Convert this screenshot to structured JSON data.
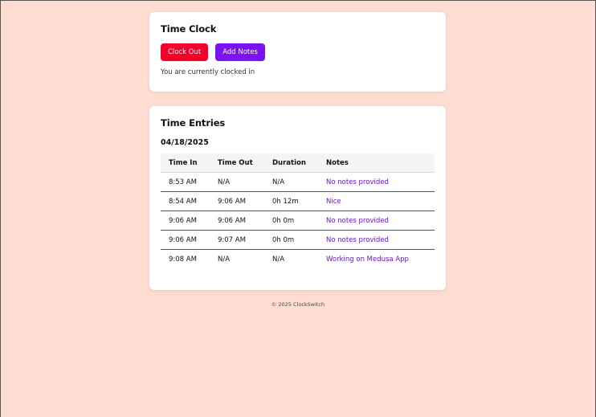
{
  "time_clock": {
    "title": "Time Clock",
    "clock_out_label": "Clock Out",
    "add_notes_label": "Add Notes",
    "status_text": "You are currently clocked in"
  },
  "time_entries": {
    "title": "Time Entries",
    "date": "04/18/2025",
    "columns": {
      "time_in": "Time In",
      "time_out": "Time Out",
      "duration": "Duration",
      "notes": "Notes"
    },
    "rows": [
      {
        "time_in": "8:53 AM",
        "time_out": "N/A",
        "duration": "N/A",
        "notes": "No notes provided"
      },
      {
        "time_in": "8:54 AM",
        "time_out": "9:06 AM",
        "duration": "0h 12m",
        "notes": "Nice"
      },
      {
        "time_in": "9:06 AM",
        "time_out": "9:06 AM",
        "duration": "0h 0m",
        "notes": "No notes provided"
      },
      {
        "time_in": "9:06 AM",
        "time_out": "9:07 AM",
        "duration": "0h 0m",
        "notes": "No notes provided"
      },
      {
        "time_in": "9:08 AM",
        "time_out": "N/A",
        "duration": "N/A",
        "notes": "Working on Medusa App"
      }
    ]
  },
  "footer": {
    "text": "© 2025 ClockSwitch"
  },
  "colors": {
    "page_background": "#ffddd2",
    "clock_out_button": "#f2002b",
    "add_notes_button": "#7a12f2",
    "notes_text": "#6b13c9"
  }
}
